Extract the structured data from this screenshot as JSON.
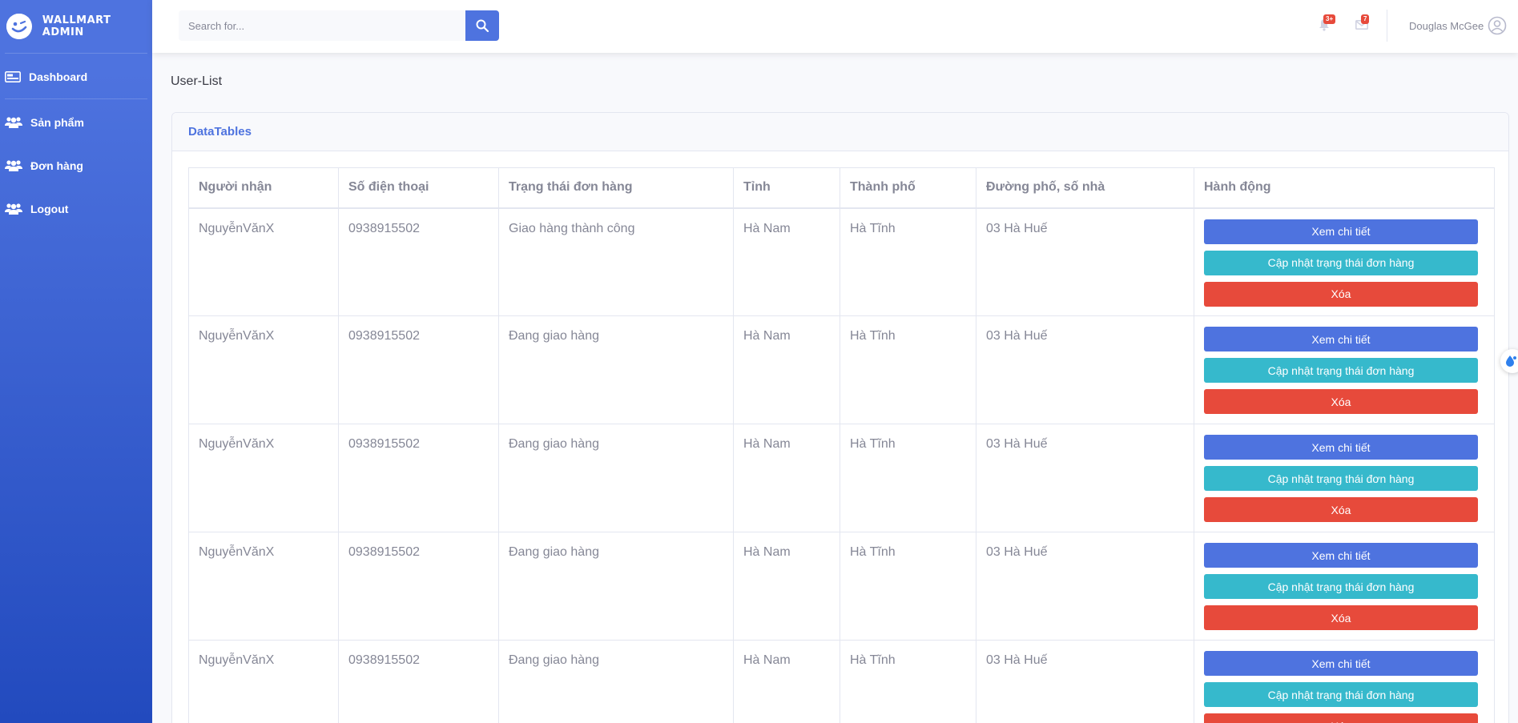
{
  "brand": {
    "title": "WALLMART ADMIN"
  },
  "sidebar": {
    "items": [
      {
        "label": "Dashboard",
        "icon": "dashboard-icon"
      },
      {
        "label": "Sản phẩm",
        "icon": "users-icon"
      },
      {
        "label": "Đơn hàng",
        "icon": "users-icon"
      },
      {
        "label": "Logout",
        "icon": "users-icon"
      }
    ]
  },
  "topbar": {
    "search_placeholder": "Search for...",
    "alerts_badge": "3+",
    "messages_badge": "7",
    "user_name": "Douglas McGee"
  },
  "page": {
    "title": "User-List"
  },
  "card": {
    "title": "DataTables"
  },
  "table": {
    "columns": [
      "Người nhận",
      "Số điện thoại",
      "Trạng thái đơn hàng",
      "Tỉnh",
      "Thành phố",
      "Đường phố, số nhà",
      "Hành động"
    ],
    "rows": [
      {
        "recipient": "NguyễnVănX",
        "phone": "0938915502",
        "status": "Giao hàng thành công",
        "province": "Hà Nam",
        "city": "Hà Tĩnh",
        "street": "03 Hà Huế"
      },
      {
        "recipient": "NguyễnVănX",
        "phone": "0938915502",
        "status": "Đang giao hàng",
        "province": "Hà Nam",
        "city": "Hà Tĩnh",
        "street": "03 Hà Huế"
      },
      {
        "recipient": "NguyễnVănX",
        "phone": "0938915502",
        "status": "Đang giao hàng",
        "province": "Hà Nam",
        "city": "Hà Tĩnh",
        "street": "03 Hà Huế"
      },
      {
        "recipient": "NguyễnVănX",
        "phone": "0938915502",
        "status": "Đang giao hàng",
        "province": "Hà Nam",
        "city": "Hà Tĩnh",
        "street": "03 Hà Huế"
      },
      {
        "recipient": "NguyễnVănX",
        "phone": "0938915502",
        "status": "Đang giao hàng",
        "province": "Hà Nam",
        "city": "Hà Tĩnh",
        "street": "03 Hà Huế"
      }
    ],
    "actions": {
      "view_label": "Xem chi tiết",
      "update_label": "Cập nhật trạng thái đơn hàng",
      "delete_label": "Xóa"
    }
  },
  "colors": {
    "primary": "#4e73df",
    "info": "#36b9cc",
    "danger": "#e74a3b",
    "sidebar_gradient_end": "#224abe"
  }
}
